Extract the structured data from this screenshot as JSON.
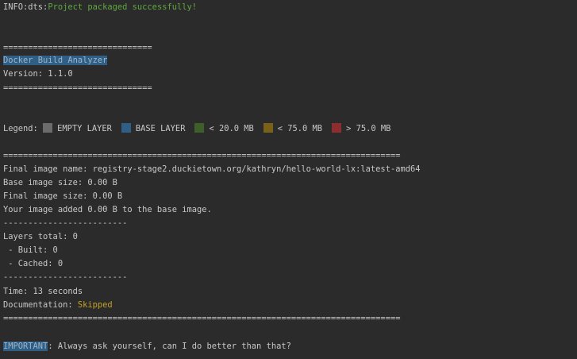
{
  "info": {
    "prefix": "INFO:dts:",
    "message": "Project packaged successfully!"
  },
  "header": {
    "separator": "==============================",
    "title": "Docker Build Analyzer",
    "version": "Version: 1.1.0"
  },
  "legend": {
    "label": "Legend:",
    "items": [
      {
        "label": "EMPTY LAYER",
        "color": "#6b6b6b"
      },
      {
        "label": "BASE LAYER",
        "color": "#2f5f86"
      },
      {
        "label": "< 20.0 MB",
        "color": "#3f5f2a"
      },
      {
        "label": "< 75.0 MB",
        "color": "#7a611a"
      },
      {
        "label": "> 75.0 MB",
        "color": "#8e2d2d"
      }
    ]
  },
  "report": {
    "separator_long": "================================================================================",
    "separator_short": "-------------------------",
    "final_image_name": "Final image name: registry-stage2.duckietown.org/kathryn/hello-world-lx:latest-amd64",
    "base_image_size": "Base image size: 0.00 B",
    "final_image_size": "Final image size: 0.00 B",
    "added": "Your image added 0.00 B to the base image.",
    "layers_total": "Layers total: 0",
    "built": " - Built: 0",
    "cached": " - Cached: 0",
    "time": "Time: 13 seconds",
    "documentation_label": "Documentation: ",
    "documentation_value": "Skipped"
  },
  "footer": {
    "important_tag": "IMPORTANT",
    "important_message": ": Always ask yourself, can I do better than that?"
  }
}
